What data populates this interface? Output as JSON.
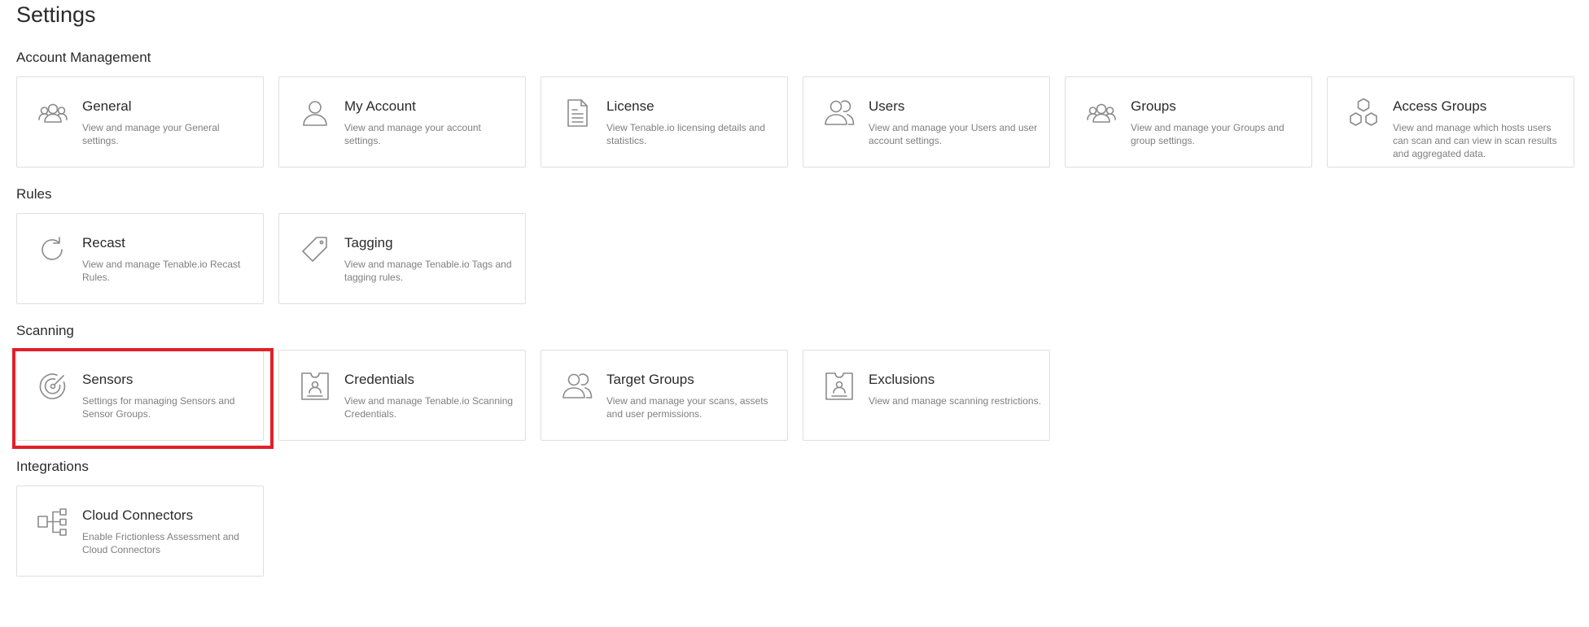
{
  "page": {
    "title": "Settings"
  },
  "sections": [
    {
      "title": "Account Management",
      "cards": [
        {
          "icon": "group-icon",
          "title": "General",
          "description": "View and manage your General settings."
        },
        {
          "icon": "user-icon",
          "title": "My Account",
          "description": "View and manage your account settings."
        },
        {
          "icon": "document-icon",
          "title": "License",
          "description": "View Tenable.io licensing details and statistics."
        },
        {
          "icon": "users-icon",
          "title": "Users",
          "description": "View and manage your Users and user account settings."
        },
        {
          "icon": "group-icon",
          "title": "Groups",
          "description": "View and manage your Groups and group settings."
        },
        {
          "icon": "hexagons-icon",
          "title": "Access Groups",
          "description": "View and manage which hosts users can scan and can view in scan results and aggregated data."
        }
      ]
    },
    {
      "title": "Rules",
      "cards": [
        {
          "icon": "recast-icon",
          "title": "Recast",
          "description": "View and manage Tenable.io Recast Rules."
        },
        {
          "icon": "tag-icon",
          "title": "Tagging",
          "description": "View and manage Tenable.io Tags and tagging rules."
        }
      ]
    },
    {
      "title": "Scanning",
      "cards": [
        {
          "icon": "radar-icon",
          "title": "Sensors",
          "description": "Settings for managing Sensors and Sensor Groups."
        },
        {
          "icon": "badge-icon",
          "title": "Credentials",
          "description": "View and manage Tenable.io Scanning Credentials."
        },
        {
          "icon": "users-icon",
          "title": "Target Groups",
          "description": "View and manage your scans, assets and user permissions."
        },
        {
          "icon": "badge-icon",
          "title": "Exclusions",
          "description": "View and manage scanning restrictions."
        }
      ]
    },
    {
      "title": "Integrations",
      "cards": [
        {
          "icon": "connectors-icon",
          "title": "Cloud Connectors",
          "description": "Enable Frictionless Assessment and Cloud Connectors"
        }
      ]
    }
  ],
  "highlighted_card": "Sensors",
  "colors": {
    "highlight": "#e0202a",
    "icon": "#8a8a8a",
    "card_border": "#dfdfdf",
    "description": "#7f7f7f"
  }
}
